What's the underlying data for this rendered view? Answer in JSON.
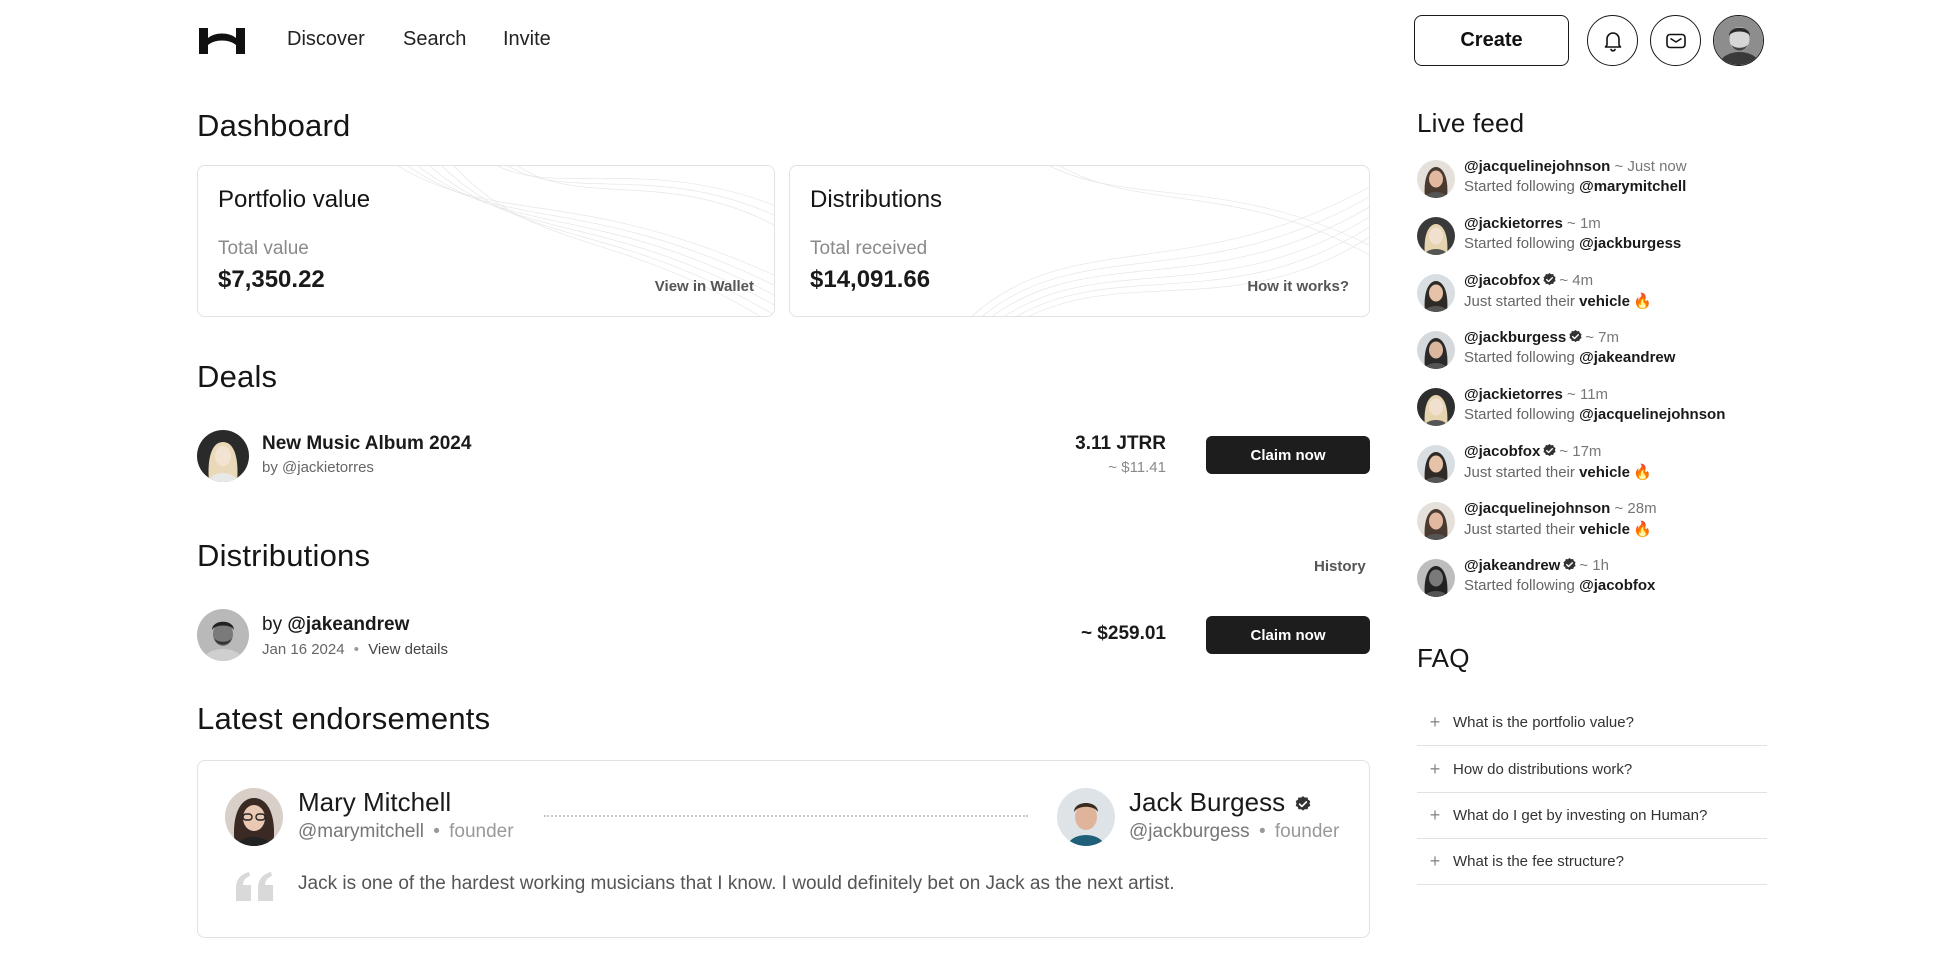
{
  "header": {
    "nav": [
      "Discover",
      "Search",
      "Invite"
    ],
    "create_label": "Create"
  },
  "dashboard": {
    "title": "Dashboard",
    "portfolio": {
      "title": "Portfolio value",
      "label": "Total value",
      "value": "$7,350.22",
      "link": "View in Wallet"
    },
    "distributions": {
      "title": "Distributions",
      "label": "Total received",
      "value": "$14,091.66",
      "link": "How it works?"
    }
  },
  "deals": {
    "title": "Deals",
    "items": [
      {
        "title": "New Music Album 2024",
        "by": "by @jackietorres",
        "amount": "3.11 JTRR",
        "amount_sub": "~ $11.41",
        "button": "Claim now"
      }
    ]
  },
  "distributions": {
    "title": "Distributions",
    "history_label": "History",
    "items": [
      {
        "by": "by",
        "handle": "@jakeandrew",
        "date": "Jan 16 2024",
        "details": "View details",
        "amount": "~ $259.01",
        "button": "Claim now"
      }
    ]
  },
  "endorsements": {
    "title": "Latest endorsements",
    "from": {
      "name": "Mary Mitchell",
      "handle": "@marymitchell",
      "role": "founder"
    },
    "to": {
      "name": "Jack Burgess",
      "handle": "@jackburgess",
      "role": "founder"
    },
    "quote": "Jack is one of the hardest working musicians that I know. I would definitely bet on Jack as the next artist."
  },
  "live_feed": {
    "title": "Live feed",
    "items": [
      {
        "handle": "@jacquelinejohnson",
        "verified": false,
        "time": "~ Just now",
        "prefix": "Started following ",
        "target": "@marymitchell",
        "emoji": ""
      },
      {
        "handle": "@jackietorres",
        "verified": false,
        "time": "~ 1m",
        "prefix": "Started following ",
        "target": "@jackburgess",
        "emoji": ""
      },
      {
        "handle": "@jacobfox",
        "verified": true,
        "time": "~ 4m",
        "prefix": "Just started their ",
        "target": "vehicle",
        "emoji": "🔥"
      },
      {
        "handle": "@jackburgess",
        "verified": true,
        "time": "~ 7m",
        "prefix": "Started following ",
        "target": "@jakeandrew",
        "emoji": ""
      },
      {
        "handle": "@jackietorres",
        "verified": false,
        "time": "~ 11m",
        "prefix": "Started following ",
        "target": "@jacquelinejohnson",
        "emoji": ""
      },
      {
        "handle": "@jacobfox",
        "verified": true,
        "time": "~ 17m",
        "prefix": "Just started their ",
        "target": "vehicle",
        "emoji": "🔥"
      },
      {
        "handle": "@jacquelinejohnson",
        "verified": false,
        "time": "~ 28m",
        "prefix": "Just started their ",
        "target": "vehicle",
        "emoji": "🔥"
      },
      {
        "handle": "@jakeandrew",
        "verified": true,
        "time": "~ 1h",
        "prefix": "Started following ",
        "target": "@jacobfox",
        "emoji": ""
      }
    ]
  },
  "faq": {
    "title": "FAQ",
    "items": [
      "What is the portfolio value?",
      "How do distributions work?",
      "What do I get by investing on Human?",
      "What is the fee structure?"
    ]
  },
  "icons": {
    "logo": "h-logo-icon",
    "bell": "bell-icon",
    "mail": "mail-icon",
    "verified": "verified-badge-icon",
    "plus": "plus-icon",
    "quote": "quote-icon"
  }
}
